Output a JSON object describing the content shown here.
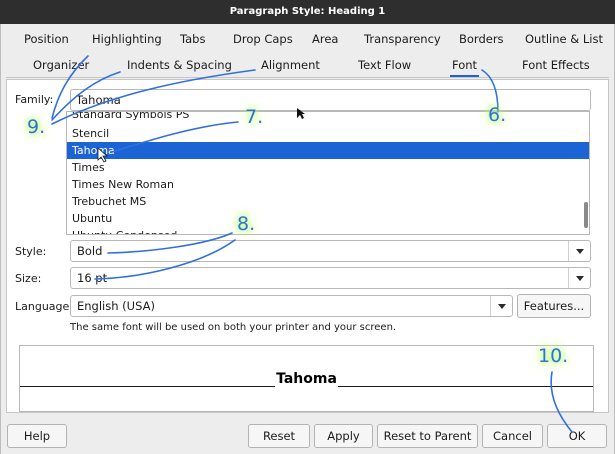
{
  "window": {
    "title": "Paragraph Style: Heading 1"
  },
  "tabs": {
    "row1": [
      "Position",
      "Highlighting",
      "Tabs",
      "Drop Caps",
      "Area",
      "Transparency",
      "Borders",
      "Outline & List"
    ],
    "row2": [
      "Organizer",
      "Indents & Spacing",
      "Alignment",
      "Text Flow",
      "Font",
      "Font Effects"
    ],
    "active": "Font"
  },
  "font": {
    "family_label": "Family:",
    "family_value": "Tahoma",
    "family_list": [
      "Standard Symbols PS",
      "Stencil",
      "Tahoma",
      "Times",
      "Times New Roman",
      "Trebuchet MS",
      "Ubuntu",
      "Ubuntu Condensed"
    ],
    "selected_family": "Tahoma",
    "style_label": "Style:",
    "style_value": "Bold",
    "size_label": "Size:",
    "size_value": "16 pt",
    "language_label": "Language:",
    "language_value": "English (USA)",
    "features_button": "Features...",
    "note": "The same font will be used on both your printer and your screen.",
    "preview_text": "Tahoma"
  },
  "buttons": {
    "help": "Help",
    "reset": "Reset",
    "apply": "Apply",
    "reset_to_parent": "Reset to Parent",
    "cancel": "Cancel",
    "ok": "OK"
  },
  "annotations": {
    "a6": "6.",
    "a7": "7.",
    "a8": "8.",
    "a9": "9.",
    "a10": "10."
  },
  "colors": {
    "title_bar": "#2e2e2e",
    "selection": "#1c63d6",
    "annotation_stroke": "#2f6fe0",
    "annotation_glow": "#b6ff6a"
  },
  "icons": {
    "dropdown": "chevron-down-icon",
    "cursor": "mouse-pointer-icon"
  }
}
